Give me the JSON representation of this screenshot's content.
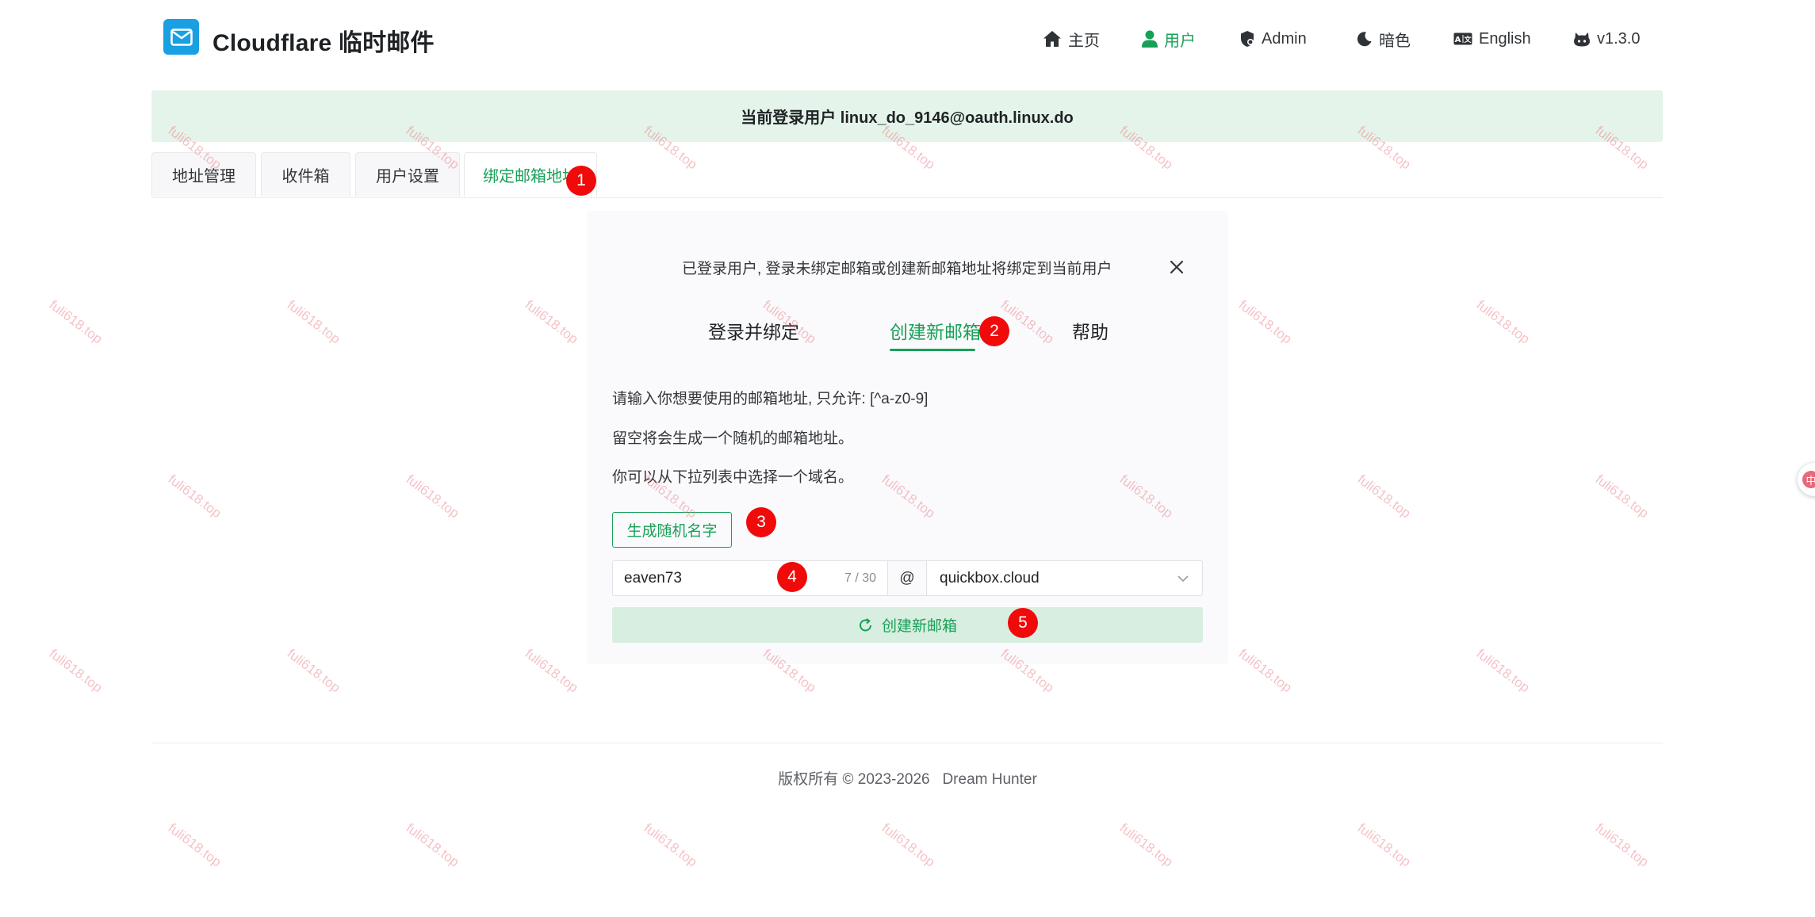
{
  "header": {
    "brand": "Cloudflare 临时邮件",
    "nav": [
      {
        "label": "主页",
        "icon": "home-icon"
      },
      {
        "label": "用户",
        "icon": "user-icon",
        "active": true
      },
      {
        "label": "Admin",
        "icon": "admin-shield-icon"
      },
      {
        "label": "暗色",
        "icon": "moon-icon"
      },
      {
        "label": "English",
        "icon": "language-icon"
      },
      {
        "label": "v1.3.0",
        "icon": "github-icon"
      }
    ]
  },
  "banner": {
    "text": "当前登录用户 linux_do_9146@oauth.linux.do"
  },
  "tabs": [
    {
      "label": "地址管理"
    },
    {
      "label": "收件箱"
    },
    {
      "label": "用户设置"
    },
    {
      "label": "绑定邮箱地址",
      "active": true
    }
  ],
  "card": {
    "info": "已登录用户, 登录未绑定邮箱或创建新邮箱地址将绑定到当前用户",
    "subtabs": [
      {
        "label": "登录并绑定"
      },
      {
        "label": "创建新邮箱",
        "active": true
      },
      {
        "label": "帮助"
      }
    ],
    "paragraphs": [
      "请输入你想要使用的邮箱地址, 只允许: [^a-z0-9]",
      "留空将会生成一个随机的邮箱地址。",
      "你可以从下拉列表中选择一个域名。"
    ],
    "random_button": "生成随机名字",
    "name_value": "eaven73",
    "name_count": "7 / 30",
    "at_symbol": "@",
    "domain_value": "quickbox.cloud",
    "create_button": "创建新邮箱"
  },
  "markers": [
    "1",
    "2",
    "3",
    "4",
    "5"
  ],
  "footer": {
    "text": "版权所有 © 2023-2026   Dream Hunter"
  },
  "watermark": "fuli618.top",
  "side_widget": "中",
  "colors": {
    "accent": "#18a058",
    "logo": "#19a0e3",
    "banner_bg": "#e5f4ea",
    "marker": "#f00a0a"
  }
}
